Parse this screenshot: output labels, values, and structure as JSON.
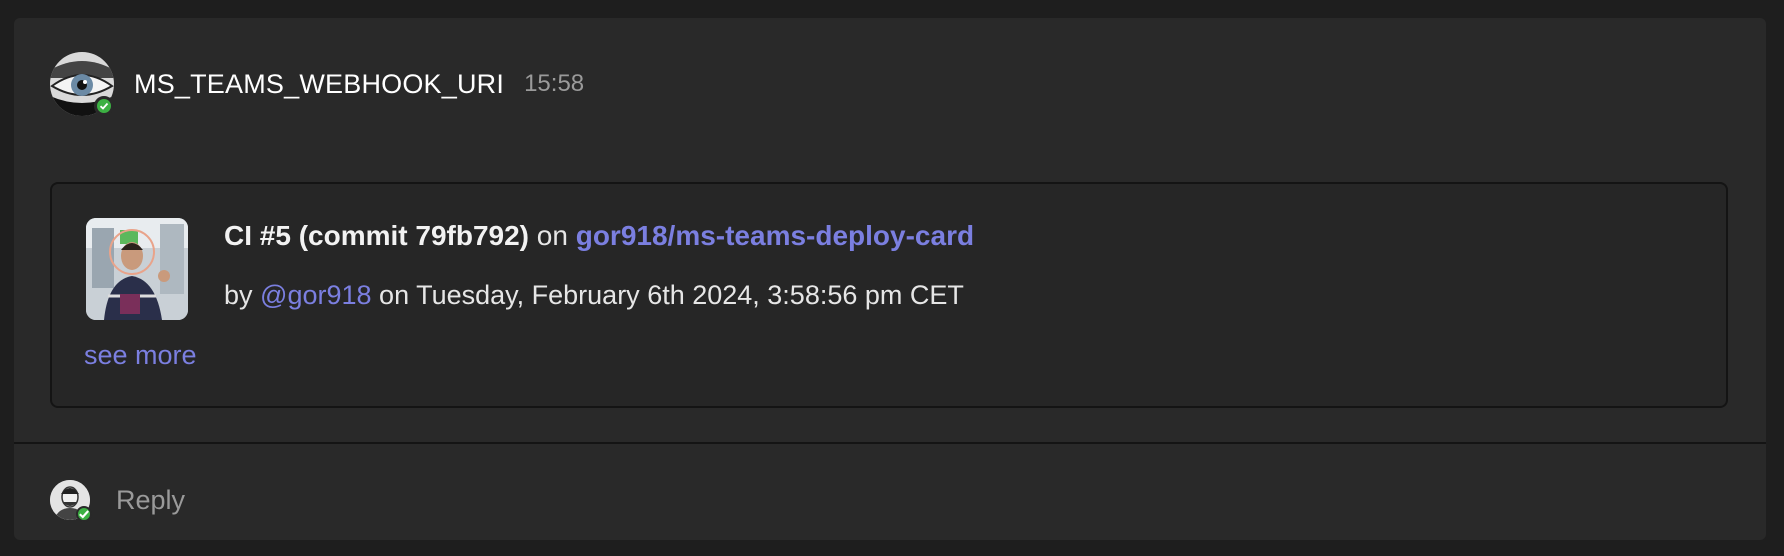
{
  "message": {
    "author": "MS_TEAMS_WEBHOOK_URI",
    "time": "15:58",
    "avatar_icon": "eye-avatar",
    "presence": "online"
  },
  "card": {
    "title_bold": "CI #5 (commit 79fb792)",
    "title_on": "on",
    "repo_link": "gor918/ms-teams-deploy-card",
    "by_prefix": "by",
    "user_link": "@gor918",
    "date_text": "on Tuesday, February 6th 2024, 3:58:56 pm CET",
    "see_more": "see more"
  },
  "reply": {
    "label": "Reply"
  },
  "colors": {
    "link": "#7b7fe0",
    "presence_online": "#3cb043",
    "background": "#292929"
  }
}
